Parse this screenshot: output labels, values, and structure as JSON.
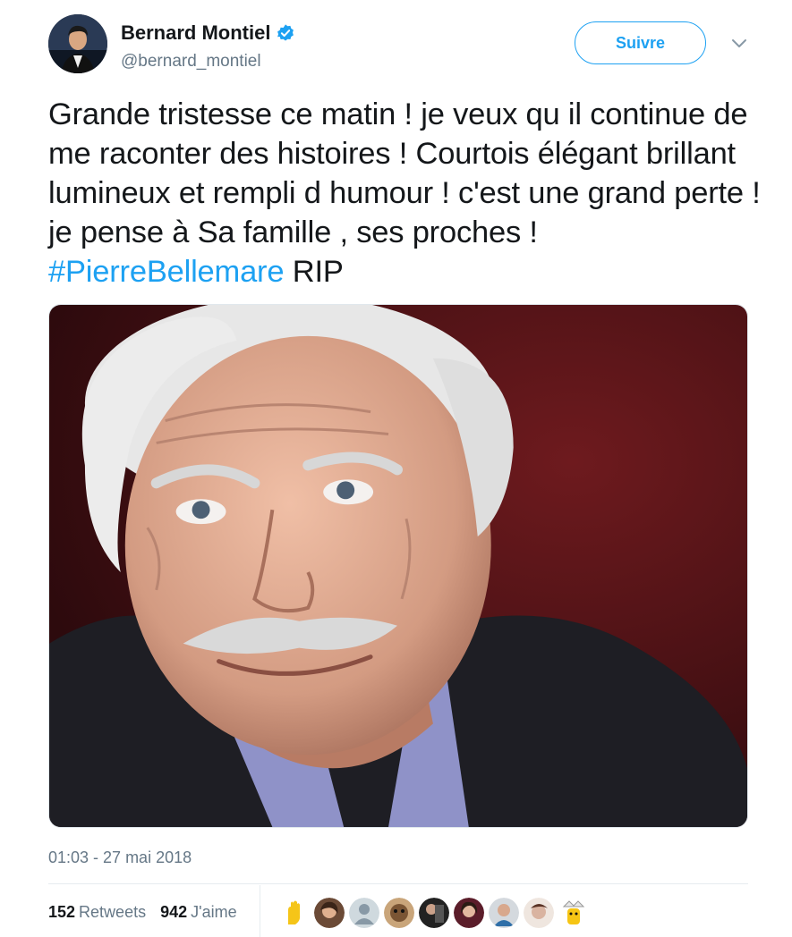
{
  "author": {
    "display_name": "Bernard Montiel",
    "handle": "@bernard_montiel",
    "verified": true
  },
  "actions": {
    "follow_label": "Suivre"
  },
  "tweet": {
    "text_before": "Grande tristesse ce matin ! je veux qu il continue de me raconter des histoires ! Courtois élégant brillant lumineux et rempli d humour ! c'est une grand perte ! je pense à Sa famille , ses proches ! ",
    "hashtag": "#PierreBellemare",
    "text_after": " RIP"
  },
  "meta": {
    "timestamp": "01:03 - 27 mai 2018"
  },
  "stats": {
    "retweets_count": "152",
    "retweets_label": "Retweets",
    "likes_count": "942",
    "likes_label": "J'aime"
  },
  "likers": [
    "liker-1",
    "liker-2",
    "liker-3",
    "liker-4",
    "liker-5",
    "liker-6",
    "liker-7",
    "liker-8",
    "liker-9",
    "liker-10"
  ],
  "colors": {
    "accent": "#1da1f2",
    "text": "#14171a",
    "muted": "#657786",
    "border": "#e6ecf0"
  },
  "icons": [
    "verified-badge-icon",
    "chevron-down-icon"
  ]
}
